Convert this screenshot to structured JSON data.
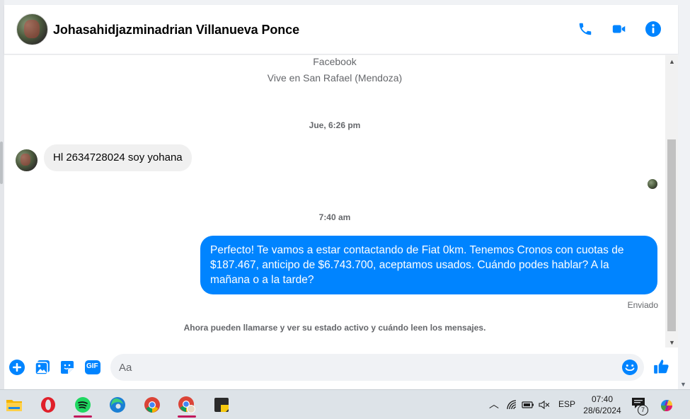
{
  "header": {
    "contact_name": "Johasahidjazminadrian Villanueva Ponce"
  },
  "profile_info": {
    "line1": "Facebook",
    "line2": "Vive en San Rafael (Mendoza)"
  },
  "messages": [
    {
      "timestamp": "Jue, 6:26 pm",
      "direction": "incoming",
      "text": "Hl 2634728024 soy yohana"
    },
    {
      "timestamp": "7:40 am",
      "direction": "outgoing",
      "text": "Perfecto! Te vamos a estar contactando de Fiat 0km. Tenemos Cronos con cuotas de $187.467, anticipo de $6.743.700, aceptamos usados. Cuándo podes hablar? A la mañana o a la tarde?",
      "status": "Enviado"
    }
  ],
  "notice": "Ahora pueden llamarse y ver su estado activo y cuándo leen los mensajes.",
  "composer": {
    "placeholder": "Aa",
    "gif_label": "GIF"
  },
  "taskbar": {
    "language": "ESP",
    "time": "07:40",
    "date": "28/6/2024",
    "notification_count": "7",
    "apps": [
      "file-explorer",
      "opera",
      "spotify",
      "edge",
      "chrome",
      "chrome-profile",
      "sticky-notes"
    ]
  },
  "colors": {
    "accent": "#0084ff",
    "incoming_bubble": "#f0f0f0"
  }
}
